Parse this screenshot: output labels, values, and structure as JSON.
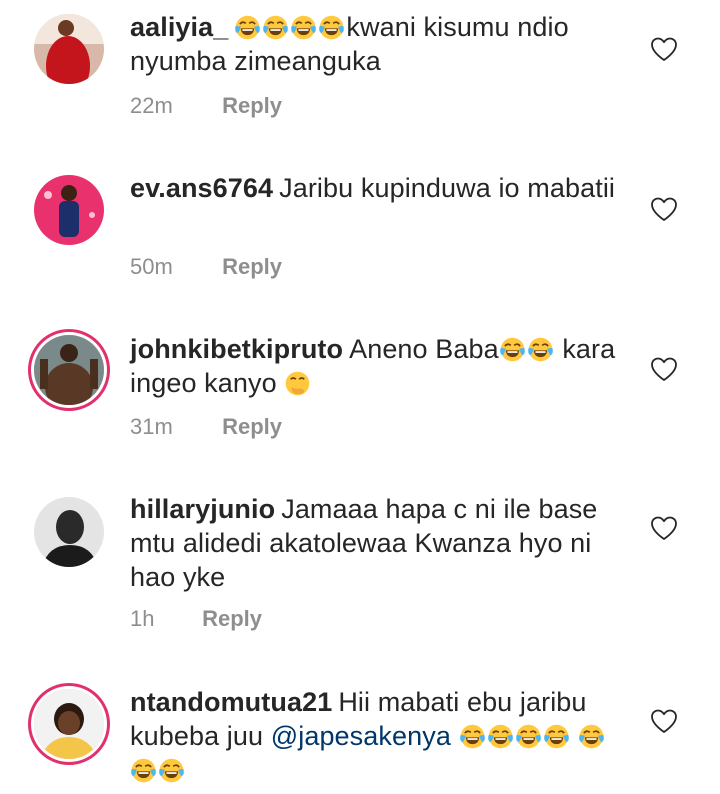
{
  "reply_label": "Reply",
  "colors": {
    "username": "#262626",
    "meta": "#8e8e8e",
    "mention": "#00376b",
    "story_ring": "#e1306c"
  },
  "comments": [
    {
      "username": "aaliyia_",
      "text_a": "",
      "text_b": "kwani kisumu ndio nyumba zimeanguka",
      "emoji_a": [
        "face-with-tears-of-joy",
        "face-with-tears-of-joy",
        "face-with-tears-of-joy",
        "face-with-tears-of-joy"
      ],
      "time": "22m",
      "avatar": "avatar-red-dress"
    },
    {
      "username": "ev.ans6764",
      "text_a": "Jaribu kupinduwa io mabatii",
      "time": "50m",
      "avatar": "avatar-pink-person"
    },
    {
      "username": "johnkibetkipruto",
      "text_a": "Aneno Baba",
      "emoji_a": [
        "face-with-tears-of-joy",
        "face-with-tears-of-joy"
      ],
      "text_b": " kara ingeo kanyo ",
      "emoji_b": [
        "face-with-hand-over-mouth"
      ],
      "time": "31m",
      "avatar": "avatar-muscle-man"
    },
    {
      "username": "hillaryjunio",
      "text_a": "Jamaaa hapa c ni ile base mtu alidedi akatolewaa Kwanza hyo ni hao yke",
      "time": "1h",
      "avatar": "avatar-grey-man"
    },
    {
      "username": "ntandomutua21",
      "text_a": "Hii mabati ebu jaribu kubeba juu ",
      "mention": "@japesakenya",
      "emoji_a": [
        "face-with-tears-of-joy",
        "face-with-tears-of-joy",
        "face-with-tears-of-joy",
        "face-with-tears-of-joy",
        "face-with-tears-of-joy",
        "face-with-tears-of-joy",
        "face-with-tears-of-joy"
      ],
      "avatar": "avatar-smiling-woman"
    }
  ]
}
